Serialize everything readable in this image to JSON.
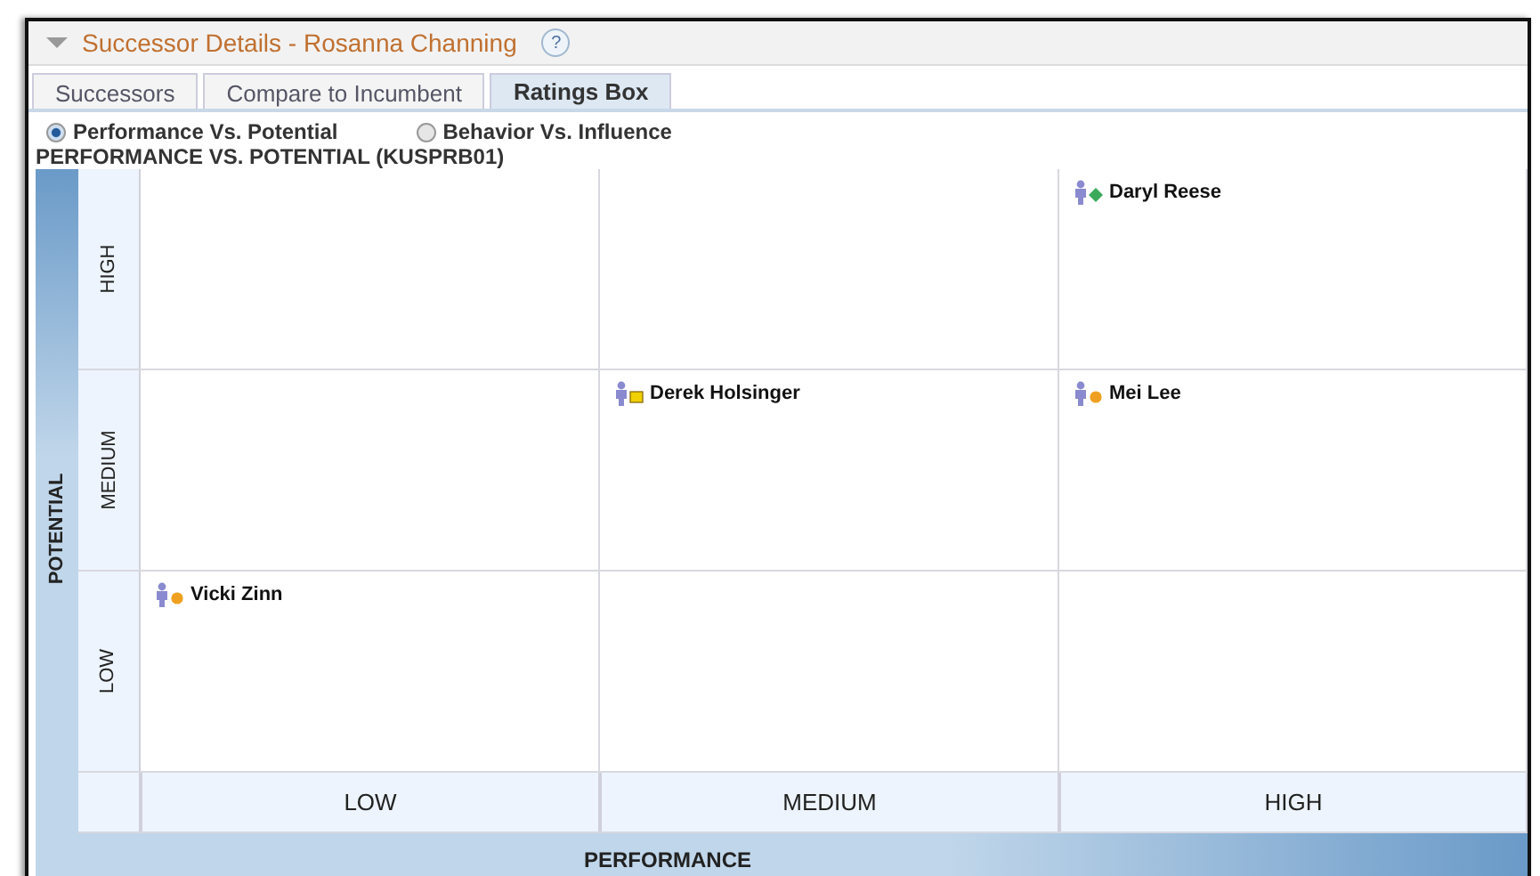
{
  "panel": {
    "title": "Successor Details - Rosanna Channing",
    "help": "?",
    "expanded": true
  },
  "tabs": [
    {
      "label": "Successors",
      "selected": false
    },
    {
      "label": "Compare to Incumbent",
      "selected": false
    },
    {
      "label": "Ratings Box",
      "selected": true
    }
  ],
  "views": [
    {
      "label": "Performance Vs. Potential",
      "selected": true
    },
    {
      "label": "Behavior Vs. Influence",
      "selected": false
    }
  ],
  "grid": {
    "title": "PERFORMANCE VS. POTENTIAL (KUSPRB01)",
    "y_axis": "POTENTIAL",
    "x_axis": "PERFORMANCE",
    "row_labels": [
      "HIGH",
      "MEDIUM",
      "LOW"
    ],
    "column_labels": [
      "LOW",
      "MEDIUM",
      "HIGH"
    ],
    "cells": [
      [
        [],
        [],
        [
          {
            "name": "Daryl Reese",
            "kind": "diamond",
            "color": "#3aaa5a"
          }
        ]
      ],
      [
        [],
        [
          {
            "name": "Derek Holsinger",
            "kind": "square",
            "color": "#f0d000"
          }
        ],
        [
          {
            "name": "Mei Lee",
            "kind": "circle",
            "color": "#f0a020"
          }
        ]
      ],
      [
        [
          {
            "name": "Vicki Zinn",
            "kind": "circle",
            "color": "#f0a020"
          }
        ],
        [],
        []
      ]
    ]
  }
}
